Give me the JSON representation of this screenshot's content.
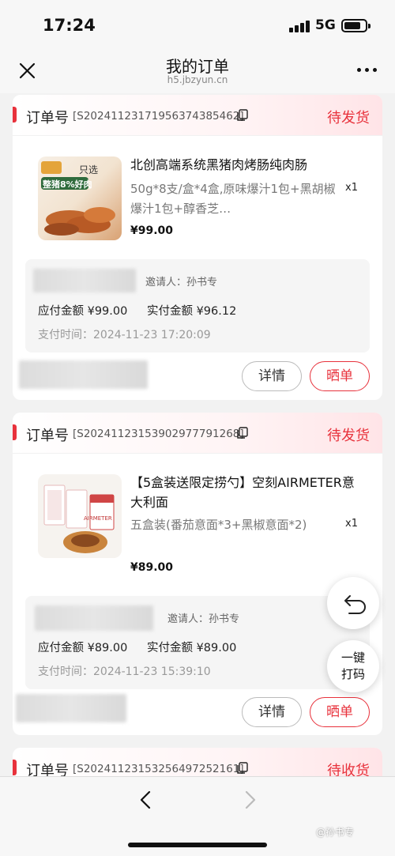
{
  "status_bar": {
    "time": "17:24",
    "network": "5G"
  },
  "nav": {
    "title": "我的订单",
    "subtitle": "h5.jbzyun.cn"
  },
  "orders": [
    {
      "label": "订单号",
      "number": "[S20241123171956374385462]",
      "status": "待发货",
      "product_name": "北创高端系统黑猪肉烤肠纯肉肠",
      "spec": "50g*8支/盒*4盒,原味爆汁1包+黑胡椒爆汁1包+醇香芝…",
      "qty": "x1",
      "price": "¥99.00",
      "thumb_text_a": "只选",
      "thumb_text_b": "整猪8%好肉",
      "inviter": "邀请人：孙书专",
      "payable": "应付金额 ¥99.00",
      "paid": "实付金额 ¥96.12",
      "pay_time": "支付时间：2024-11-23 17:20:09",
      "detail_btn": "详情",
      "show_btn": "晒单"
    },
    {
      "label": "订单号",
      "number": "[S20241123153902977791268]",
      "status": "待发货",
      "product_name": "【5盒装送限定捞勺】空刻AIRMETER意大利面",
      "spec": "五盒装(番茄意面*3+黑椒意面*2)",
      "qty": "x1",
      "price": "¥89.00",
      "thumb_text_a": "AIRMETER",
      "inviter": "邀请人：孙书专",
      "payable": "应付金额 ¥89.00",
      "paid": "实付金额 ¥89.00",
      "pay_time": "支付时间：2024-11-23 15:39:10",
      "detail_btn": "详情",
      "show_btn": "晒单"
    },
    {
      "label": "订单号",
      "number": "[S20241123153256497252161]",
      "status": "待收货"
    }
  ],
  "fab": {
    "print_label": "一键打码"
  },
  "watermark": "@孙书专",
  "colors": {
    "accent": "#e8323c",
    "page_bg": "#f2f2f2"
  }
}
